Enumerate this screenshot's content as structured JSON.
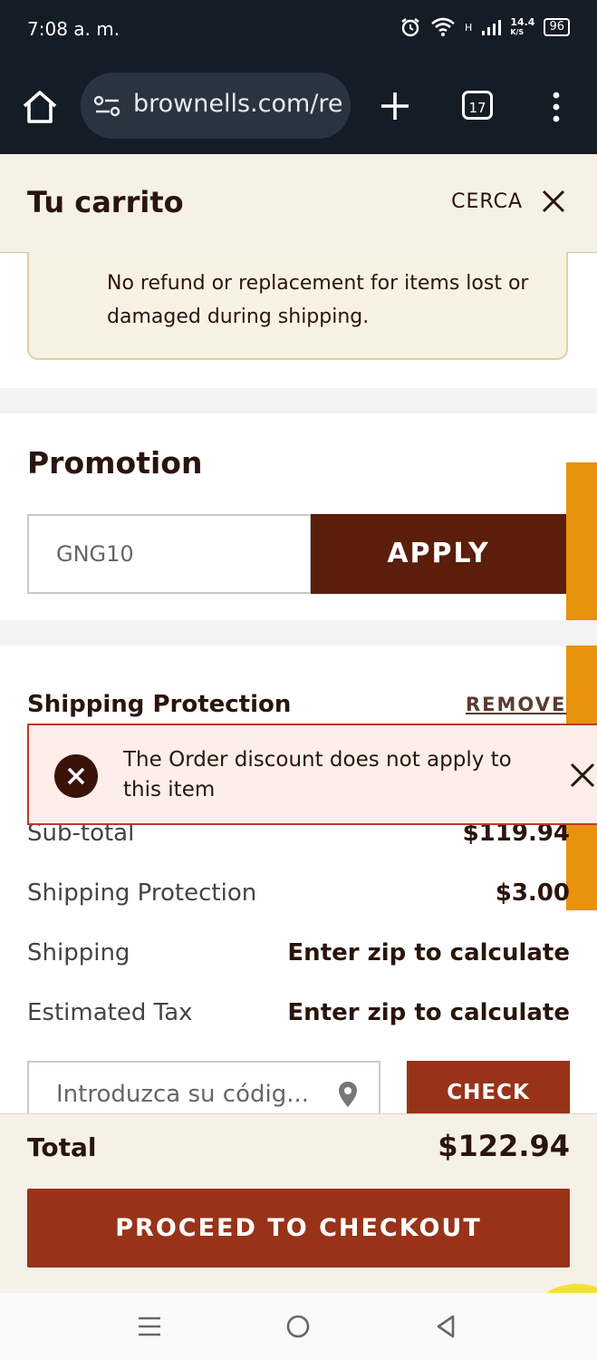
{
  "status_bar": {
    "time": "7:08 a. m.",
    "network": "H",
    "speed": "14.4",
    "speed_unit": "K/S",
    "battery": "96"
  },
  "browser": {
    "url": "brownells.com/re",
    "tab_count": "17"
  },
  "cart": {
    "title": "Tu carrito",
    "close_label": "CERCA"
  },
  "notice": {
    "text": "No refund or replacement for items lost or damaged during shipping."
  },
  "promotion": {
    "title": "Promotion",
    "code_value": "GNG10",
    "apply_label": "APPLY"
  },
  "shipping_protection": {
    "title": "Shipping Protection",
    "remove_label": "REMOVE"
  },
  "error_toast": {
    "message": "The Order discount does not apply to this item"
  },
  "summary": {
    "rows": [
      {
        "label": "Sub-total",
        "value": "$119.94"
      },
      {
        "label": "Shipping Protection",
        "value": "$3.00"
      },
      {
        "label": "Shipping",
        "value": "Enter zip to calculate"
      },
      {
        "label": "Estimated Tax",
        "value": "Enter zip to calculate"
      }
    ]
  },
  "zip": {
    "placeholder": "Introduzca su códig...",
    "check_label": "CHECK"
  },
  "total": {
    "label": "Total",
    "value": "$122.94"
  },
  "checkout": {
    "label": "PROCEED TO CHECKOUT"
  },
  "colors": {
    "brand_dark": "#5a1e0a",
    "brand_cta": "#98331a",
    "accent_tab": "#e8910b",
    "error_border": "#c0392b",
    "cream": "#f6f1e6"
  }
}
